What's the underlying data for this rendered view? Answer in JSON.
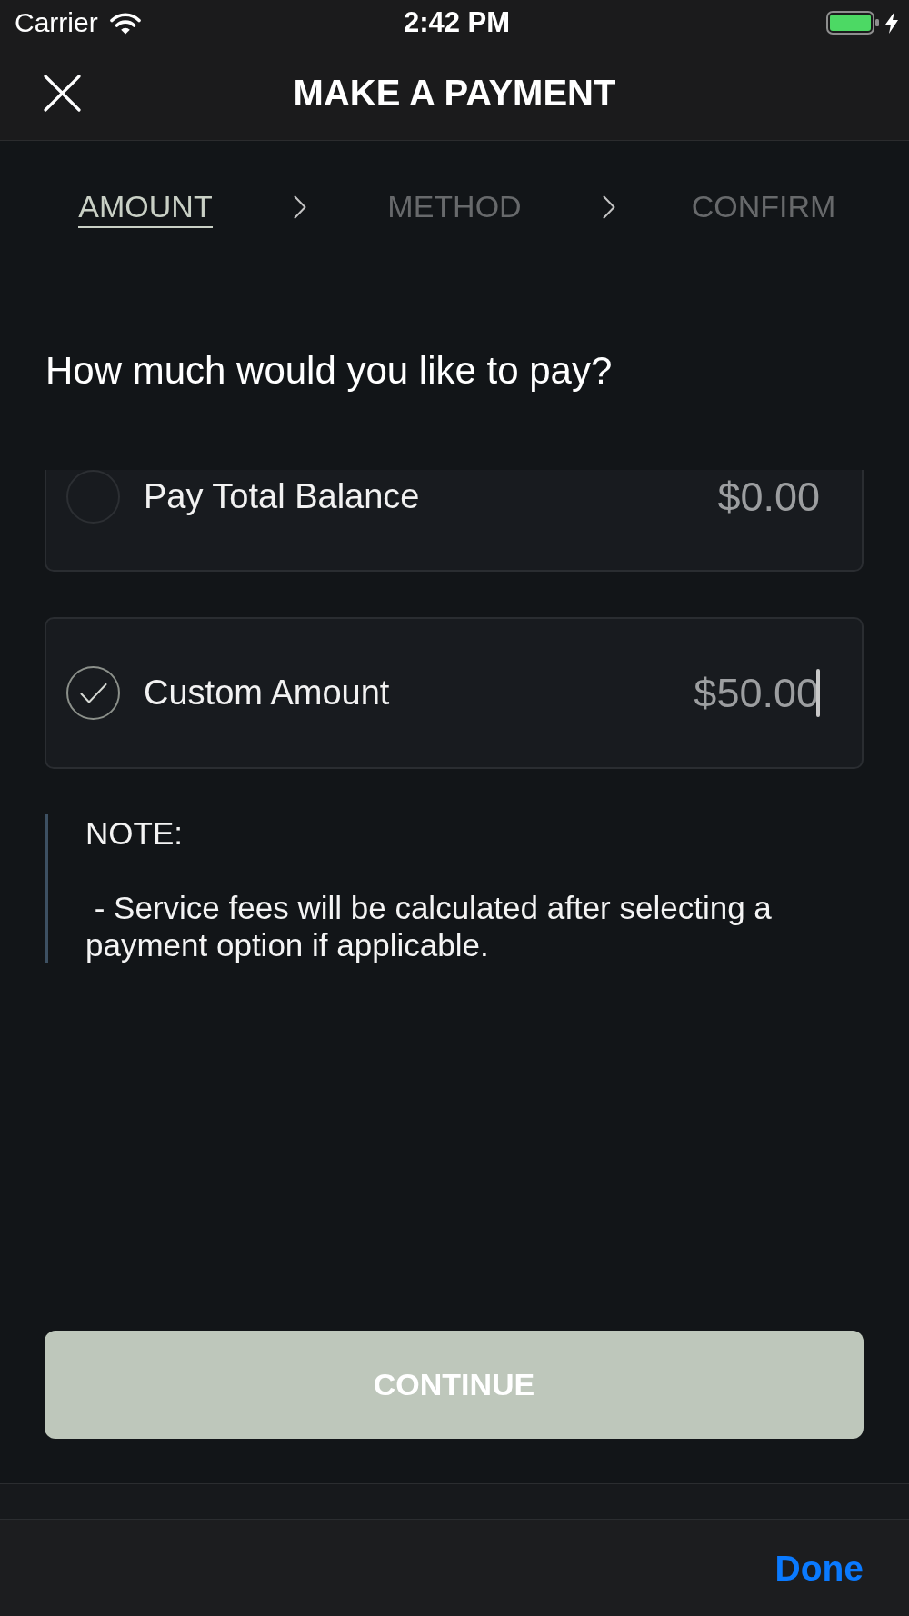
{
  "status_bar": {
    "carrier": "Carrier",
    "time": "2:42 PM"
  },
  "nav_bar": {
    "title": "MAKE A PAYMENT"
  },
  "steps": [
    {
      "label": "AMOUNT",
      "selected": true
    },
    {
      "label": "METHOD",
      "selected": false
    },
    {
      "label": "CONFIRM",
      "selected": false
    }
  ],
  "question": "How much would you like to pay?",
  "options": [
    {
      "label": "Pay Total Balance",
      "amount": "$0.00",
      "selected": false,
      "focused": false
    },
    {
      "label": "Custom Amount",
      "amount": "$50.00",
      "selected": true,
      "focused": true
    }
  ],
  "note": "NOTE:\n\n - Service fees will be calculated after selecting a payment option if applicable.",
  "continue_button": {
    "label": "CONTINUE"
  },
  "keyboard_toolbar": {
    "done": "Done"
  }
}
